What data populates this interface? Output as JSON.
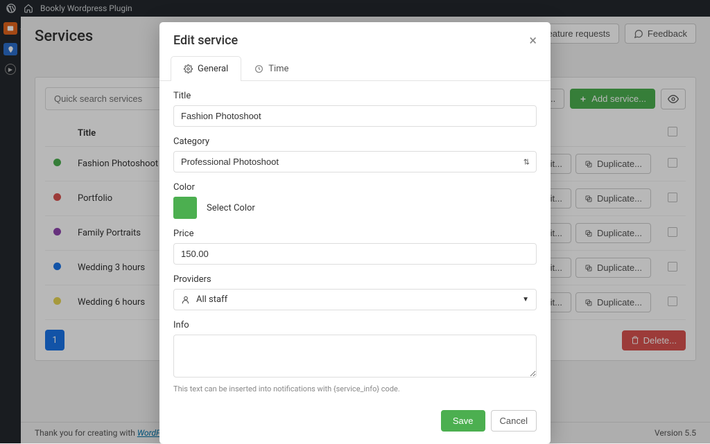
{
  "topbar": {
    "site_name": "Bookly Wordpress Plugin"
  },
  "page": {
    "title": "Services"
  },
  "header_buttons": {
    "feature": "Feature requests",
    "feedback": "Feedback",
    "categories": "...gories...",
    "add_service": "Add service..."
  },
  "search": {
    "placeholder": "Quick search services"
  },
  "table": {
    "title_col": "Title",
    "rows": [
      {
        "color": "#4caf50",
        "name": "Fashion Photoshoot",
        "edit": "Edit...",
        "dup": "Duplicate..."
      },
      {
        "color": "#d9534f",
        "name": "Portfolio",
        "edit": "Edit...",
        "dup": "Duplicate..."
      },
      {
        "color": "#8e44ad",
        "name": "Family Portraits",
        "edit": "Edit...",
        "dup": "Duplicate..."
      },
      {
        "color": "#1a73e8",
        "name": "Wedding 3 hours",
        "edit": "Edit...",
        "dup": "Duplicate..."
      },
      {
        "color": "#e6d454",
        "name": "Wedding 6 hours",
        "edit": "Edit...",
        "dup": "Duplicate..."
      }
    ]
  },
  "pagination": {
    "current": "1"
  },
  "delete_label": "Delete...",
  "footer": {
    "thanks_prefix": "Thank you for creating with ",
    "thanks_link": "WordPress",
    "thanks_suffix": ".",
    "version": "Version 5.5"
  },
  "modal": {
    "title": "Edit service",
    "tabs": {
      "general": "General",
      "time": "Time"
    },
    "labels": {
      "title": "Title",
      "category": "Category",
      "color": "Color",
      "select_color": "Select Color",
      "price": "Price",
      "providers": "Providers",
      "all_staff": "All staff",
      "info": "Info"
    },
    "values": {
      "title": "Fashion Photoshoot",
      "category": "Professional Photoshoot",
      "swatch_color": "#4caf50",
      "price": "150.00",
      "info": ""
    },
    "hint": "This text can be inserted into notifications with {service_info} code.",
    "buttons": {
      "save": "Save",
      "cancel": "Cancel"
    }
  }
}
